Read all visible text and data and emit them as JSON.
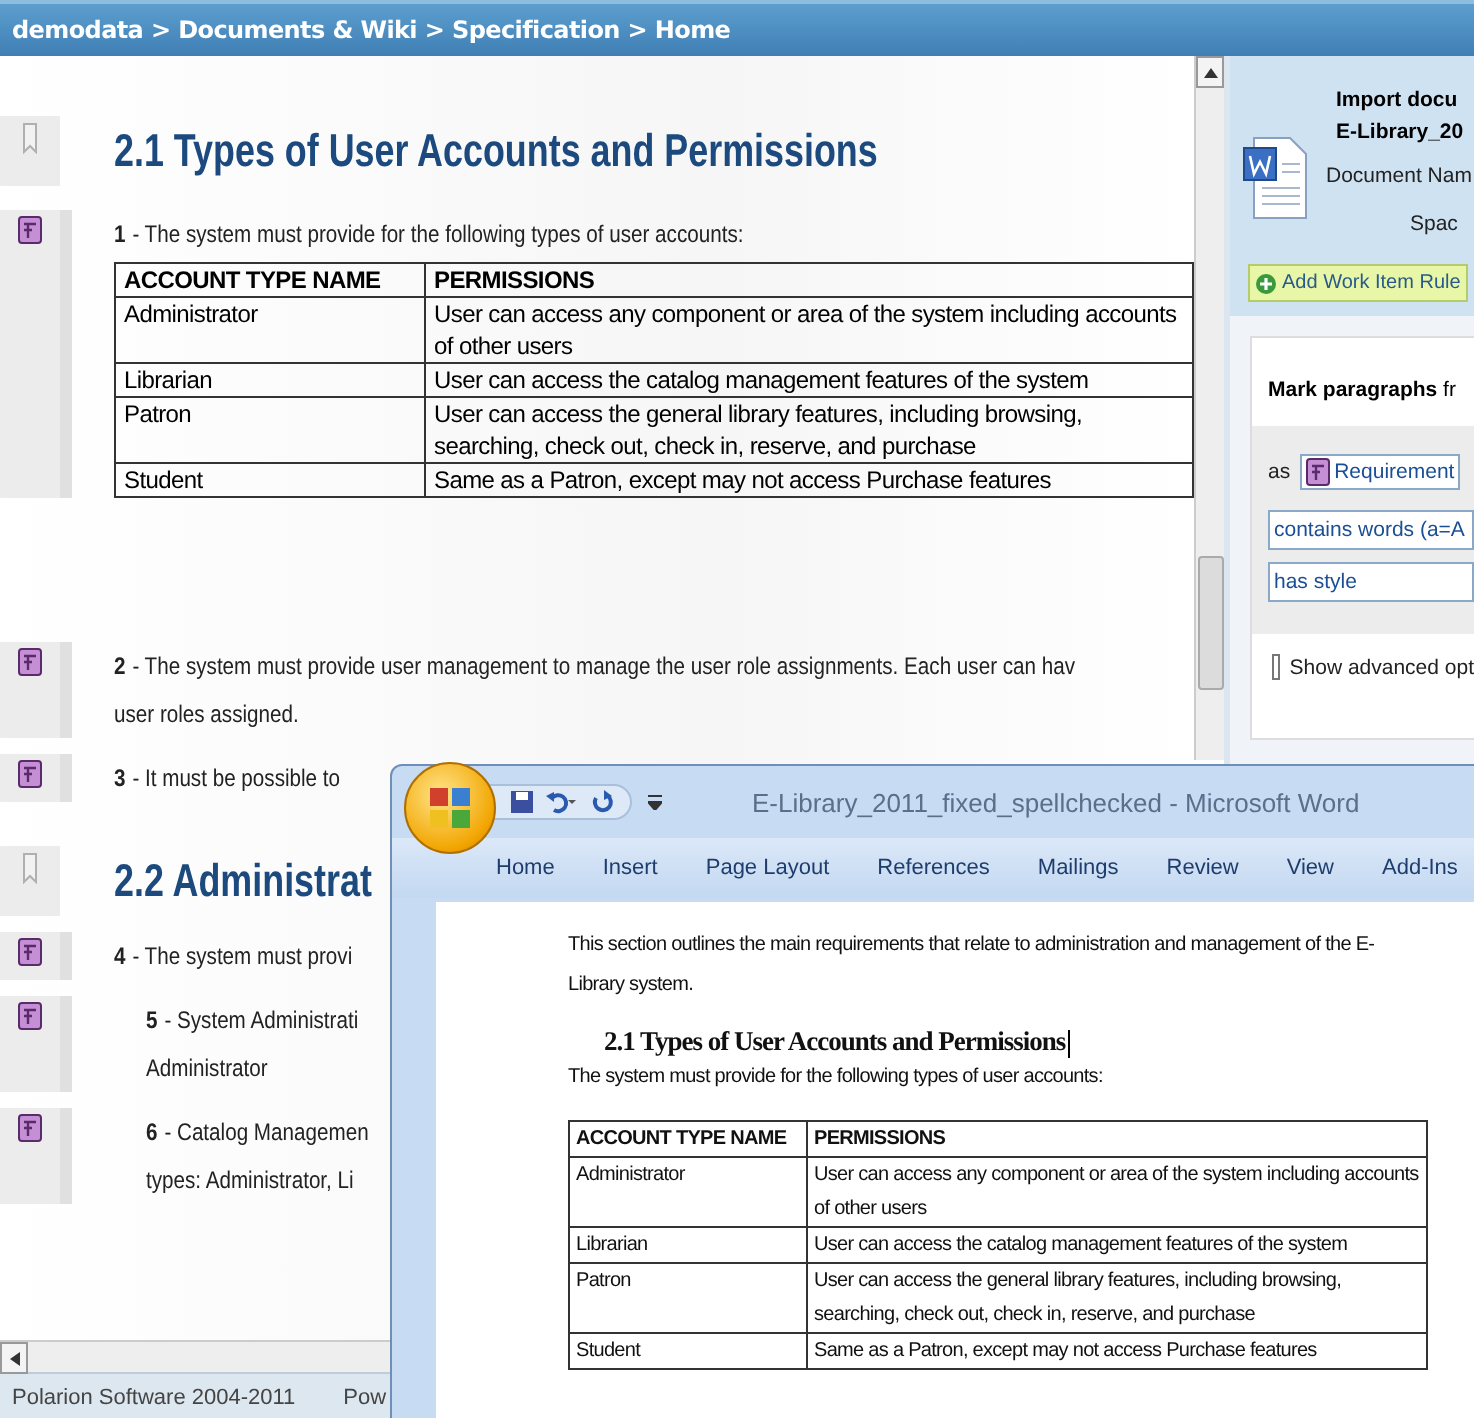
{
  "breadcrumb": "demodata > Documents & Wiki > Specification > Home",
  "document": [
    {
      "kind": "heading",
      "text": "2.1 Types of User Accounts and Permissions"
    },
    {
      "kind": "requirement",
      "number": "1",
      "text": "- The system must provide for the following types of user accounts:",
      "indented": false,
      "table": {
        "columns": [
          "ACCOUNT TYPE NAME",
          "PERMISSIONS"
        ],
        "rows": [
          [
            "Administrator",
            "User can access any component or area of the system including accounts of other users"
          ],
          [
            "Librarian",
            "User can access the catalog management features of the system"
          ],
          [
            "Patron",
            "User can access the general library features, including browsing, searching, check out, check in, reserve, and purchase"
          ],
          [
            "Student",
            "Same as a Patron, except may not access Purchase features"
          ]
        ]
      }
    },
    {
      "kind": "requirement",
      "number": "2",
      "text": "- The system must provide user management to manage the user role assignments. Each user can hav",
      "continuation": "user roles assigned.",
      "indented": false
    },
    {
      "kind": "requirement",
      "number": "3",
      "text": "- It must be possible to",
      "indented": false
    },
    {
      "kind": "heading",
      "text": "2.2 Administrat"
    },
    {
      "kind": "requirement",
      "number": "4",
      "text": "- The system must provi",
      "indented": false
    },
    {
      "kind": "requirement",
      "number": "5",
      "text": "- System Administrati",
      "continuation": "Administrator",
      "indented": true
    },
    {
      "kind": "requirement",
      "number": "6",
      "text": "- Catalog Managemen",
      "continuation": "types: Administrator, Li",
      "indented": true
    }
  ],
  "side_panel": {
    "title": "Import docu",
    "file": "E-Library_20",
    "document_name_label": "Document Nam",
    "space_label": "Spac",
    "add_rule_button": "Add Work Item Rule",
    "mark_label": "**Mark paragraphs** fr",
    "as_label": "as",
    "type_dropdown": "Requirement",
    "conditions": [
      "contains words (a=A",
      "has style"
    ],
    "advanced": {
      "label": "Show advanced opt",
      "checked": false
    }
  },
  "status_bar": {
    "copyright": "Polarion Software 2004-2011",
    "powered": "Pow"
  },
  "word_window": {
    "title": "E-Library_2011_fixed_spellchecked - Microsoft Word",
    "tabs": [
      {
        "label": "Home",
        "selected": false
      },
      {
        "label": "Insert",
        "selected": false
      },
      {
        "label": "Page Layout",
        "selected": false
      },
      {
        "label": "References",
        "selected": false
      },
      {
        "label": "Mailings",
        "selected": false
      },
      {
        "label": "Review",
        "selected": false
      },
      {
        "label": "View",
        "selected": false
      },
      {
        "label": "Add-Ins",
        "selected": false
      }
    ],
    "intro": "This section outlines the main requirements that relate to administration and management of the E-Library system.",
    "heading": "2.1 Types of User Accounts and Permissions",
    "lead": "The system must provide for the following types of user accounts:",
    "table": {
      "columns": [
        "ACCOUNT TYPE NAME",
        "PERMISSIONS"
      ],
      "rows": [
        [
          "Administrator",
          "User can access any component or area of the system including accounts of other users"
        ],
        [
          "Librarian",
          "User can access the catalog management features of the system"
        ],
        [
          "Patron",
          "User can access the general library features, including browsing, searching, check out, check in, reserve, and purchase"
        ],
        [
          "Student",
          "Same as a Patron, except may not access Purchase features"
        ]
      ]
    }
  }
}
